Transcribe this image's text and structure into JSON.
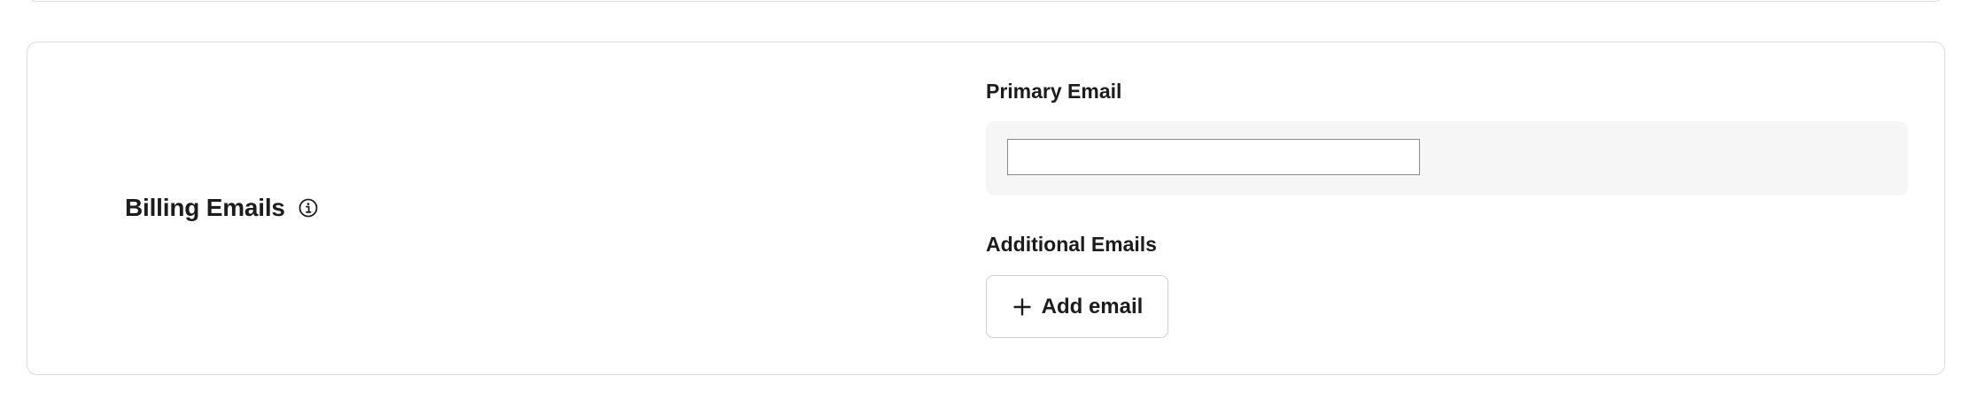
{
  "billing": {
    "title": "Billing Emails",
    "info_icon": "info-icon",
    "primary_label": "Primary Email",
    "primary_value": "",
    "primary_placeholder": "",
    "additional_label": "Additional Emails",
    "add_button_label": "Add email",
    "add_icon": "plus-icon"
  }
}
